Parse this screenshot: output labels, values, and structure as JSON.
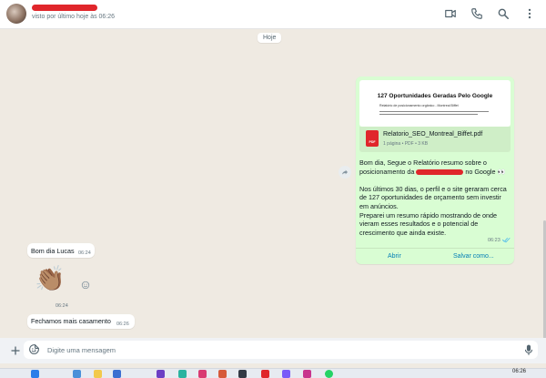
{
  "header": {
    "last_seen": "visto por último hoje às 06:26",
    "icons": [
      "video-icon",
      "phone-icon",
      "search-icon",
      "more-vert-icon"
    ]
  },
  "chat": {
    "date_chip": "Hoje",
    "outgoing_message": {
      "document_preview": {
        "title": "127 Oportunidades Geradas Pelo Google",
        "subtitle": "Relatório de posicionamento orgânico - Montreal Biffet"
      },
      "file": {
        "name": "Relatorio_SEO_Montreal_Biffet.pdf",
        "meta": "1 página • PDF • 3 KB",
        "icon_label": "PDF"
      },
      "text": {
        "line1": "Bom dia, Segue o Relatório resumo sobre o",
        "line2_prefix": "posicionamento da",
        "line2_suffix": "no Google 👀",
        "paragraph2": "Nos últimos 30 dias, o perfil e o site geraram cerca de 127 oportunidades de orçamento sem investir em anúncios.",
        "paragraph3": "Preparei um resumo rápido mostrando de onde vieram esses resultados e o potencial de crescimento que ainda existe."
      },
      "time": "06:23",
      "buttons": {
        "open": "Abrir",
        "save_as": "Salvar como..."
      }
    },
    "incoming_messages": [
      {
        "text": "Bom dia Lucas",
        "time": "06:24"
      },
      {
        "emoji": "👏🏽",
        "time": "06:24"
      },
      {
        "text": "Fechamos mais casamento",
        "time": "06:26"
      }
    ]
  },
  "input_bar": {
    "placeholder": "Digite uma mensagem"
  },
  "taskbar": {
    "time": "06:26"
  },
  "colors": {
    "outgoing_bubble": "#d9fdd3",
    "incoming_bubble": "#ffffff",
    "chat_background": "#efeae2",
    "link": "#027eb5",
    "redaction": "#e0262b"
  }
}
